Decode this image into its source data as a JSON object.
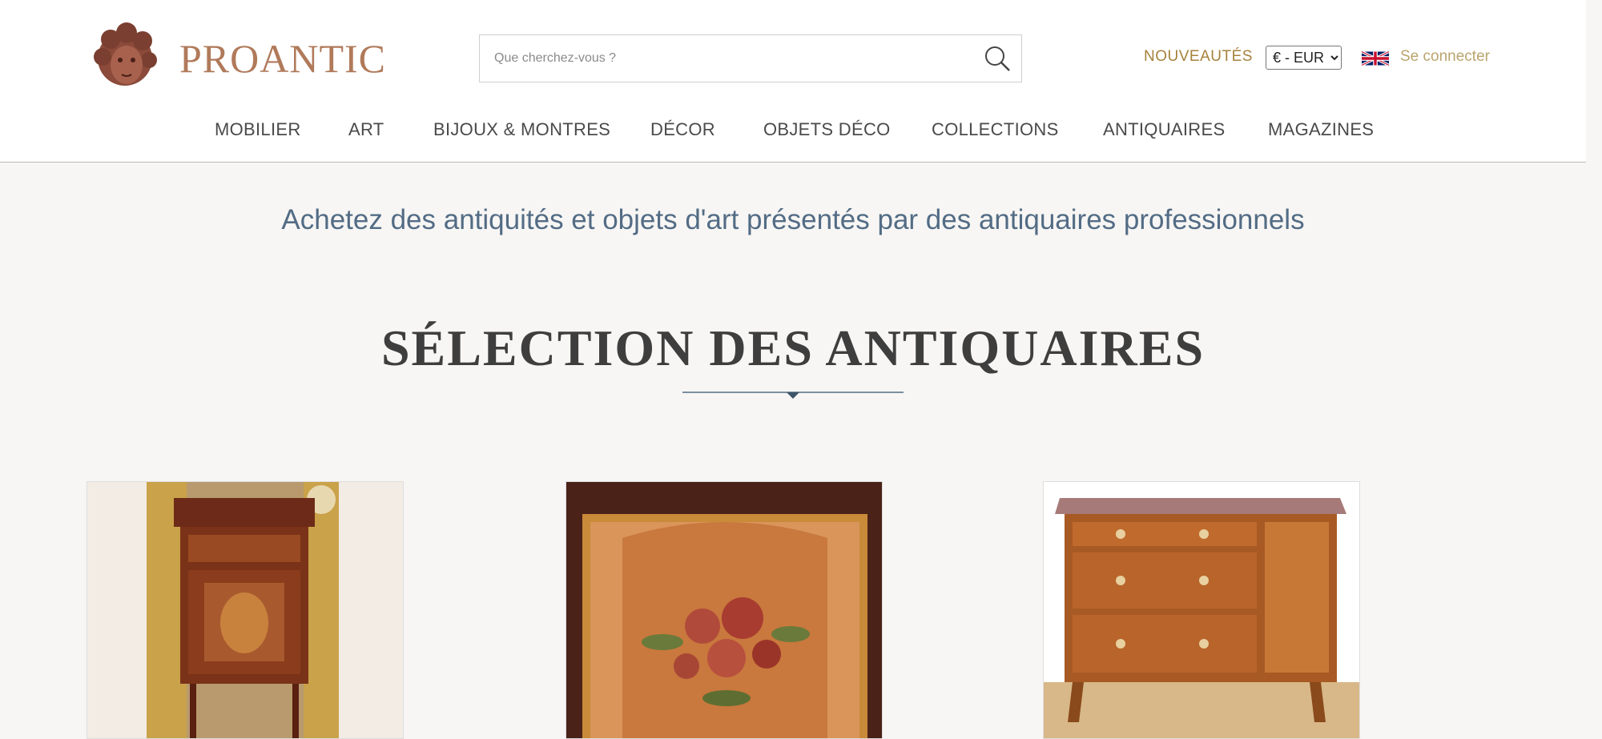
{
  "brand": {
    "name": "PROANTIC"
  },
  "search": {
    "placeholder": "Que cherchez-vous ?"
  },
  "header": {
    "new_label": "NOUVEAUTÉS",
    "currency_selected": "€ - EUR",
    "login_label": "Se connecter",
    "accent_color": "#a6823d"
  },
  "nav": {
    "items": [
      "MOBILIER",
      "ART",
      "BIJOUX & MONTRES",
      "DÉCOR",
      "OBJETS DÉCO",
      "COLLECTIONS",
      "ANTIQUAIRES",
      "MAGAZINES"
    ]
  },
  "main": {
    "tagline": "Achetez des antiquités et objets d'art présentés par des antiquaires professionnels",
    "section_title": "SÉLECTION DES ANTIQUAIRES"
  },
  "products": [
    {
      "image": "inlaid-bedside-cabinet"
    },
    {
      "image": "framed-floral-tapestry"
    },
    {
      "image": "marble-top-commode"
    }
  ],
  "icons": {
    "search": "search-icon",
    "flag": "uk-flag-icon",
    "logo": "cherub-head-logo"
  }
}
